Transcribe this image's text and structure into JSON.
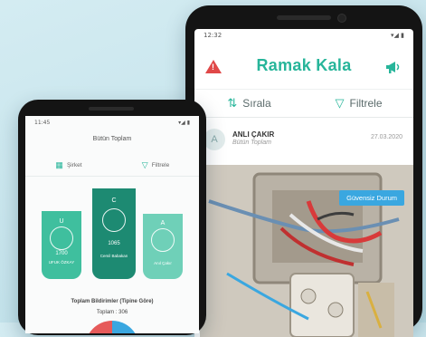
{
  "right_app": {
    "status_time": "12:32",
    "status_icons": "▾◢ ▮",
    "title": "Ramak Kala",
    "tabs": [
      {
        "label": "Sırala",
        "icon": "sort-icon"
      },
      {
        "label": "Filtrele",
        "icon": "filter-icon"
      }
    ],
    "post": {
      "avatar_letter": "A",
      "user": "ANLI ÇAKIR",
      "subtitle": "Bütün Toplam",
      "date": "27.03.2020",
      "badge": "Güvensiz Durum"
    },
    "colors": {
      "accent": "#27b59a",
      "warning": "#e04848",
      "badge": "#3aa7e0"
    }
  },
  "left_app": {
    "status_time": "11:45",
    "status_icons": "▾◢ ▮",
    "title": "Bütün Toplam",
    "tabs": [
      {
        "label": "Şirket",
        "icon": "building-icon"
      },
      {
        "label": "Filtrele",
        "icon": "filter-icon"
      }
    ],
    "cards": [
      {
        "letter": "U",
        "count": "1700",
        "name": "UFUK ÖZKAY",
        "color": "#3fbf9e",
        "level": 0.75
      },
      {
        "letter": "C",
        "count": "1065",
        "name": "Cemil Babakan",
        "color": "#1d8a72",
        "level": 1.0
      },
      {
        "letter": "A",
        "count": "",
        "name": "Anıl Çakır",
        "color": "#6fd0b8",
        "level": 0.72
      }
    ],
    "caption": "Toplam Bildirimler (Tipine Göre)",
    "total": "Toplam : 306"
  }
}
